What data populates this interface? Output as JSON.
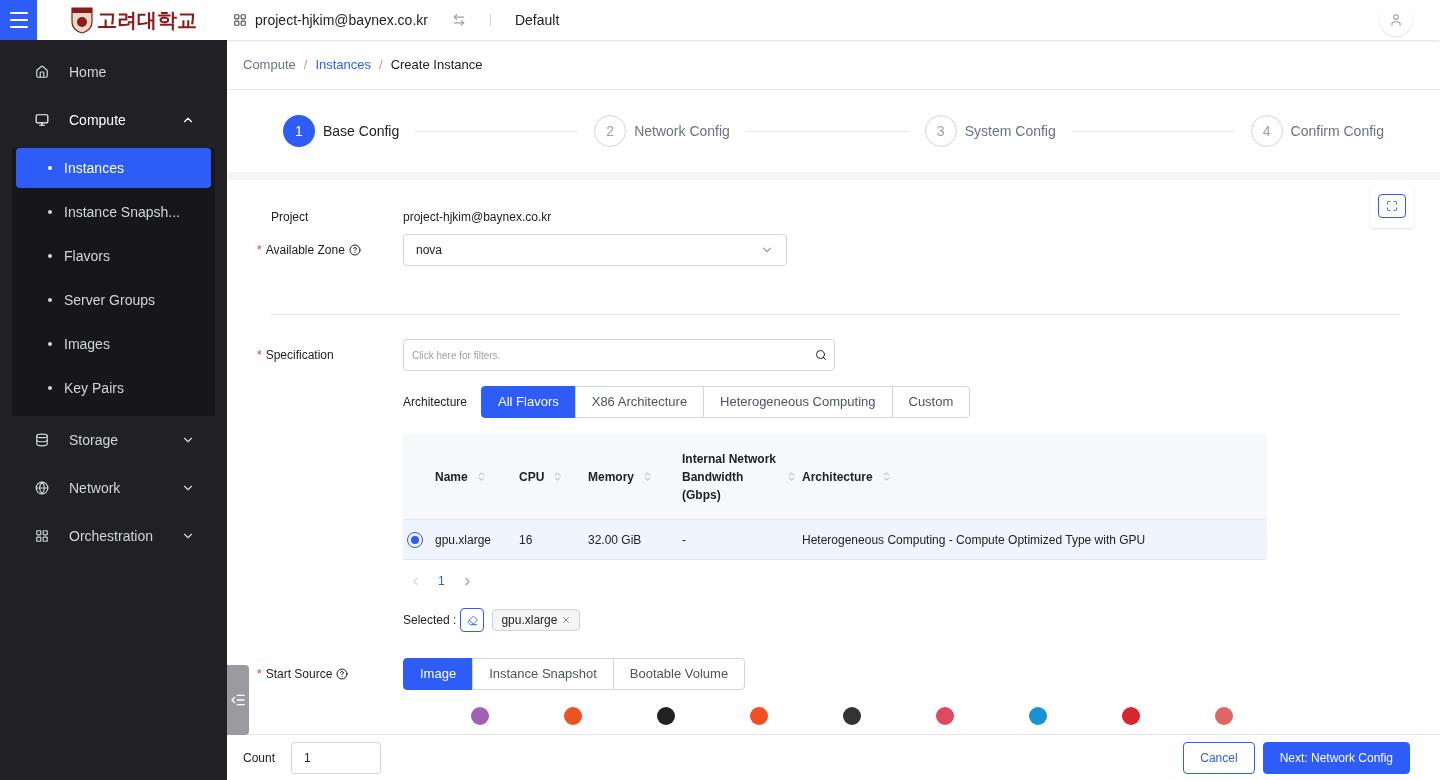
{
  "header": {
    "logo_text": "고려대학교",
    "project": "project-hjkim@baynex.co.kr",
    "workspace": "Default"
  },
  "sidebar": {
    "items": [
      {
        "label": "Home",
        "expanded": false,
        "selected": false
      },
      {
        "label": "Compute",
        "expanded": true,
        "selected": false,
        "children": [
          {
            "label": "Instances",
            "selected": true
          },
          {
            "label": "Instance Snapsh...",
            "selected": false
          },
          {
            "label": "Flavors",
            "selected": false
          },
          {
            "label": "Server Groups",
            "selected": false
          },
          {
            "label": "Images",
            "selected": false
          },
          {
            "label": "Key Pairs",
            "selected": false
          }
        ]
      },
      {
        "label": "Storage",
        "expanded": false,
        "selected": false
      },
      {
        "label": "Network",
        "expanded": false,
        "selected": false
      },
      {
        "label": "Orchestration",
        "expanded": false,
        "selected": false
      }
    ]
  },
  "breadcrumb": [
    {
      "label": "Compute",
      "kind": "plain"
    },
    {
      "separator": "/",
      "label": "Instances",
      "kind": "link"
    },
    {
      "separator": "/",
      "label": "Create Instance",
      "kind": "current"
    }
  ],
  "steps": [
    {
      "number": "1",
      "label": "Base Config",
      "selected": true
    },
    {
      "number": "2",
      "label": "Network Config",
      "selected": false
    },
    {
      "number": "3",
      "label": "System Config",
      "selected": false
    },
    {
      "number": "4",
      "label": "Confirm Config",
      "selected": false
    }
  ],
  "form": {
    "project": {
      "label": "Project",
      "value": "project-hjkim@baynex.co.kr"
    },
    "zone": {
      "label": "Available Zone",
      "required_mark": "*",
      "value": "nova"
    },
    "specification": {
      "label": "Specification",
      "required_mark": "*",
      "placeholder": "Click here for filters."
    },
    "architecture": {
      "label": "Architecture",
      "options": [
        {
          "label": "All Flavors",
          "selected": true
        },
        {
          "label": "X86 Architecture",
          "selected": false
        },
        {
          "label": "Heterogeneous Computing",
          "selected": false
        },
        {
          "label": "Custom",
          "selected": false
        }
      ]
    },
    "table": {
      "columns": [
        "Name",
        "CPU",
        "Memory",
        "Internal Network Bandwidth (Gbps)",
        "Architecture"
      ],
      "rows": [
        {
          "selected": true,
          "cells": [
            "gpu.xlarge",
            "16",
            "32.00 GiB",
            "-",
            "Heterogeneous Computing - Compute Optimized Type with GPU"
          ]
        }
      ]
    },
    "pagination": {
      "page": "1"
    },
    "selected": {
      "label": "Selected :",
      "tags": [
        "gpu.xlarge"
      ]
    },
    "start_source": {
      "label": "Start Source",
      "required_mark": "*",
      "options": [
        {
          "label": "Image",
          "selected": true
        },
        {
          "label": "Instance Snapshot",
          "selected": false
        },
        {
          "label": "Bootable Volume",
          "selected": false
        }
      ]
    }
  },
  "footer": {
    "count_label": "Count",
    "count_value": "1",
    "buttons": [
      {
        "label": "Cancel",
        "kind": "secondary"
      },
      {
        "label": "Next: Network Config",
        "kind": "primary"
      }
    ]
  }
}
